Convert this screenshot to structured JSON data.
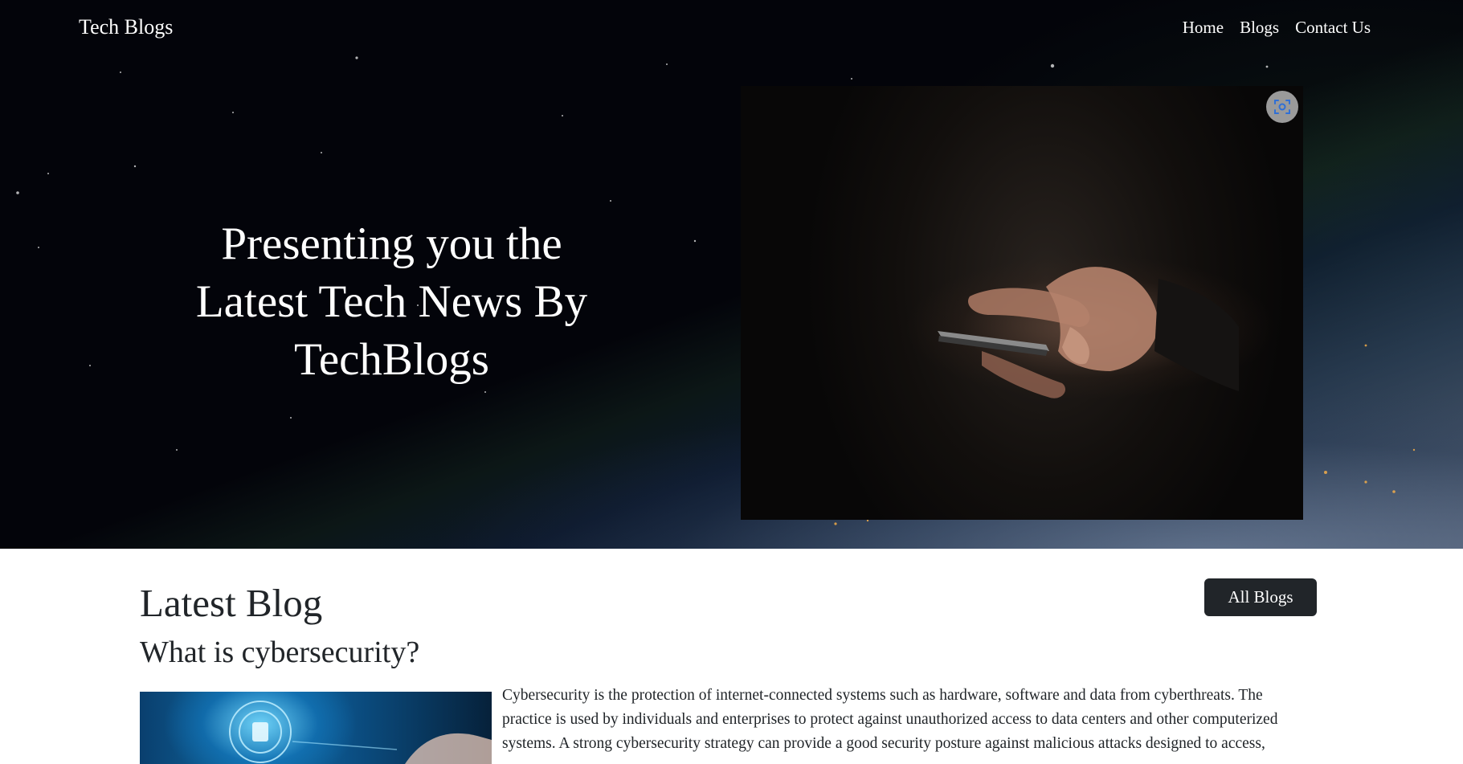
{
  "nav": {
    "brand": "Tech Blogs",
    "links": [
      "Home",
      "Blogs",
      "Contact Us"
    ]
  },
  "hero": {
    "title": "Presenting you the Latest Tech News By TechBlogs",
    "image_icon": "visual-search-icon"
  },
  "latest": {
    "heading": "Latest Blog",
    "all_blogs_button": "All Blogs",
    "post": {
      "title": "What is cybersecurity?",
      "excerpt": "Cybersecurity is the protection of internet-connected systems such as hardware, software and data from cyberthreats. The practice is used by individuals and enterprises to protect against unauthorized access to data centers and other computerized systems. A strong cybersecurity strategy can provide a good security posture against malicious attacks designed to access,"
    }
  },
  "colors": {
    "primary_text": "#212529",
    "button_bg": "#212529",
    "hero_text": "#ffffff"
  }
}
